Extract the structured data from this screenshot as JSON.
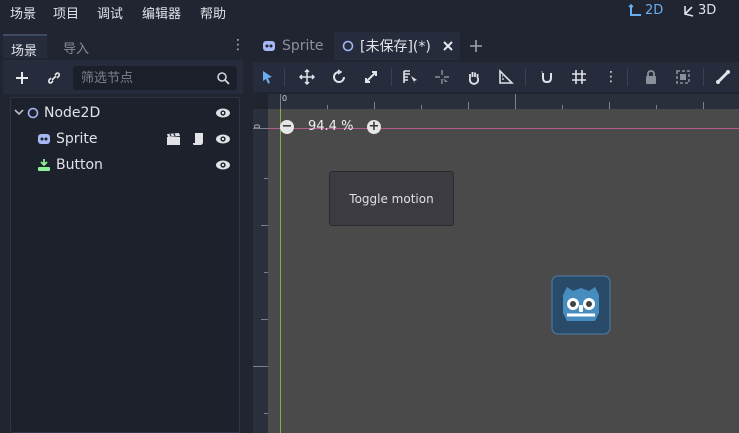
{
  "menubar": {
    "items": [
      "场景",
      "项目",
      "调试",
      "编辑器",
      "帮助"
    ],
    "mode_2d": "2D",
    "mode_3d": "3D"
  },
  "dock": {
    "tabs": [
      "场景",
      "导入"
    ],
    "filter_placeholder": "筛选节点",
    "tree": [
      {
        "label": "Node2D",
        "icon": "node2d-circle-icon"
      },
      {
        "label": "Sprite",
        "icon": "sprite-icon"
      },
      {
        "label": "Button",
        "icon": "button-icon"
      }
    ]
  },
  "editor": {
    "tabs": [
      "Sprite",
      "[未保存](*)"
    ],
    "zoom": "94.4 %",
    "ruler_top_zero": "0",
    "ruler_left_zero": "0",
    "toggle_button_label": "Toggle motion"
  },
  "colors": {
    "accent": "#5fa2e8",
    "viewport_bg": "#4a4a4a",
    "dock_bg": "#202531"
  }
}
